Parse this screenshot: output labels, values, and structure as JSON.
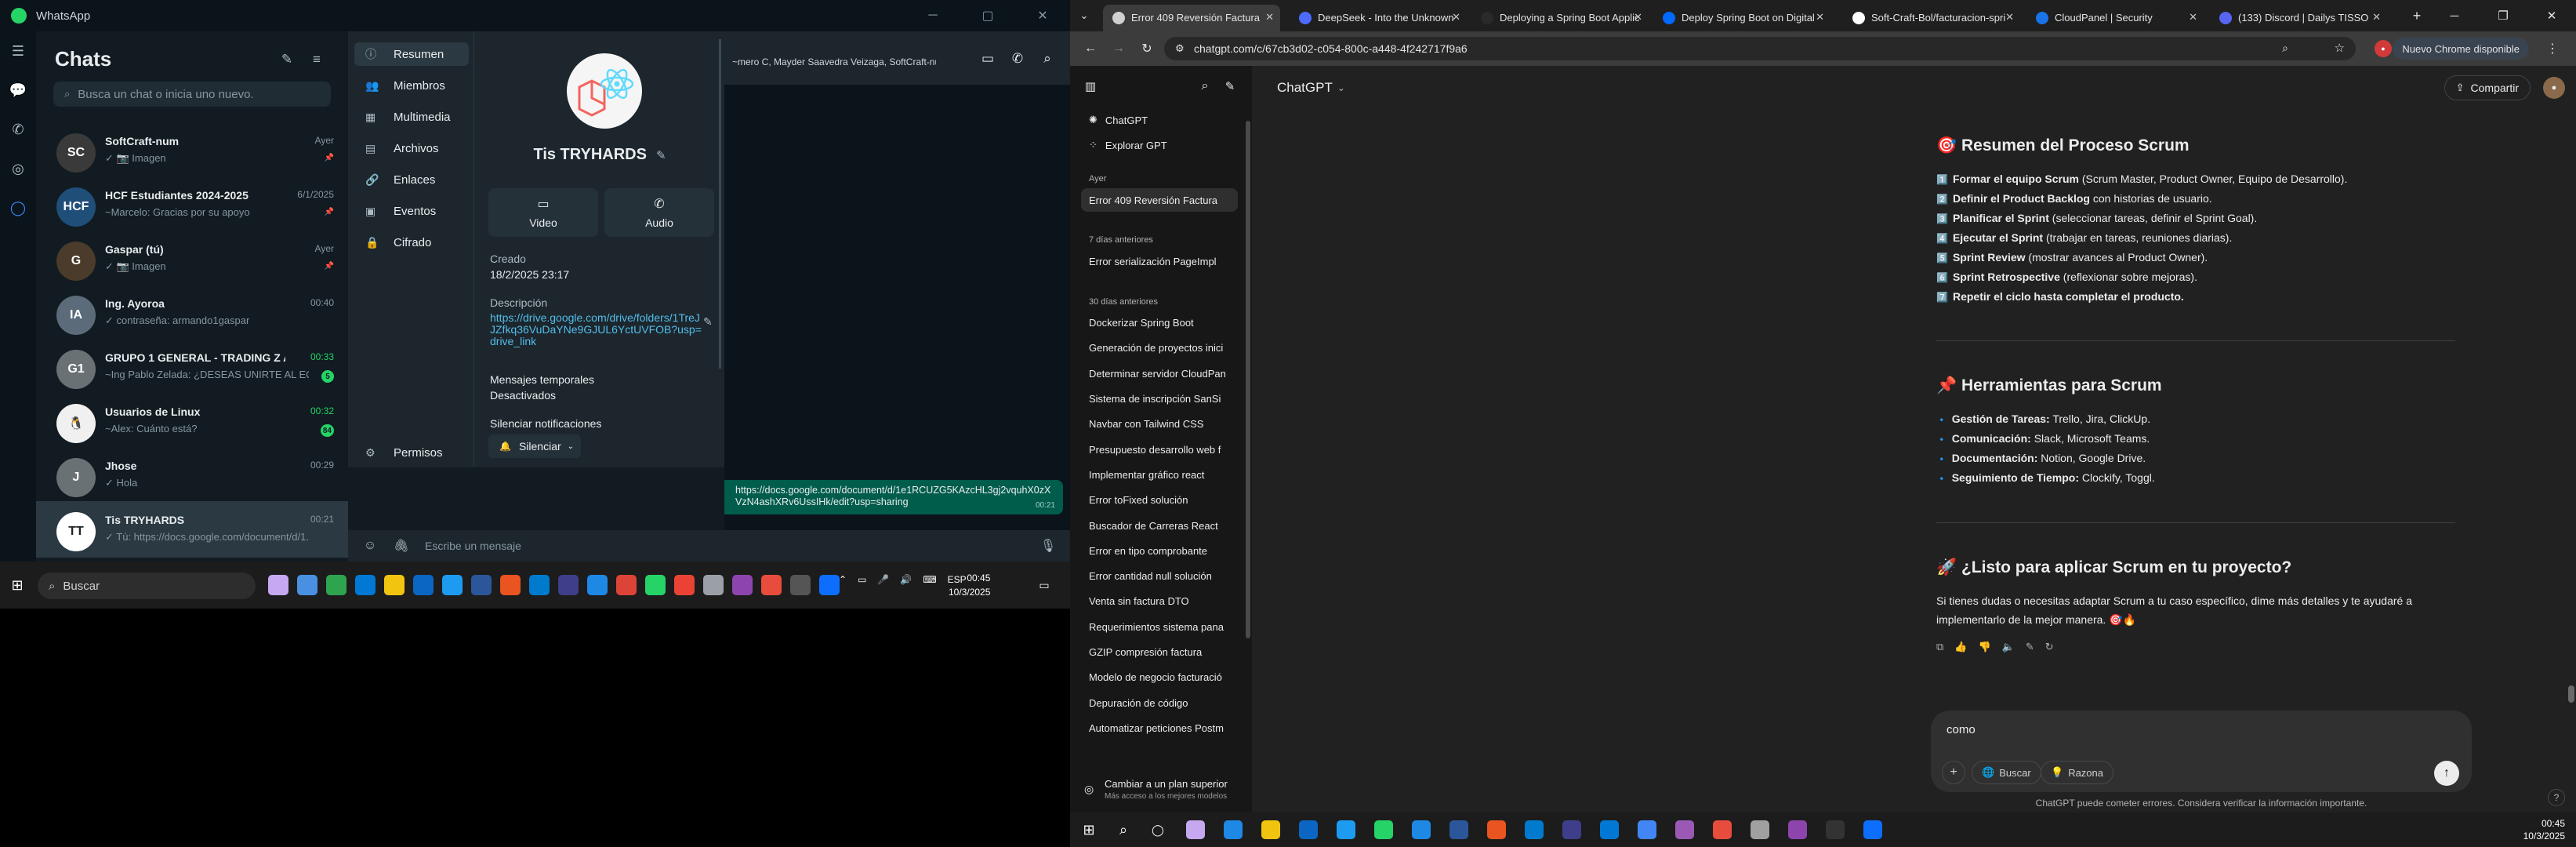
{
  "whatsapp": {
    "title": "WhatsApp",
    "list_title": "Chats",
    "search_placeholder": "Busca un chat o inicia uno nuevo.",
    "chats": [
      {
        "name": "SoftCraft-num",
        "preview": "✓ 📷 Imagen",
        "time": "Ayer",
        "avatar": "SC"
      },
      {
        "name": "HCF Estudiantes 2024-2025",
        "preview": "~Marcelo: Gracias por su apoyo",
        "time": "6/1/2025",
        "avatar": "HCF"
      },
      {
        "name": "Gaspar (tú)",
        "preview": "✓ 📷 Imagen",
        "time": "Ayer",
        "avatar": "G"
      },
      {
        "name": "Ing. Ayoroa",
        "preview": "✓ contraseña: armando1gaspar",
        "time": "00:40",
        "avatar": "IA"
      },
      {
        "name": "GRUPO 1 GENERAL - TRADING Z ACADE...",
        "preview": "~Ing Pablo Zelada: ¿DESEAS UNIRTE AL EQUIP...",
        "time": "00:33",
        "avatar": "G1",
        "badge": "5"
      },
      {
        "name": "Usuarios de Linux",
        "preview": "~Alex: Cuánto está?",
        "time": "00:32",
        "avatar": "🐧",
        "badge": "84"
      },
      {
        "name": "Jhose",
        "preview": "✓ Hola",
        "time": "00:29",
        "avatar": "J"
      },
      {
        "name": "Tis TRYHARDS",
        "preview": "✓ Tú: https://docs.google.com/document/d/1...",
        "time": "00:21",
        "avatar": "TT"
      }
    ],
    "info_nav": [
      "Resumen",
      "Miembros",
      "Multimedia",
      "Archivos",
      "Enlaces",
      "Eventos",
      "Cifrado",
      "Permisos"
    ],
    "info_nav_icons": [
      "ⓘ",
      "👥",
      "▦",
      "▤",
      "🔗",
      "▣",
      "🔒",
      "⚙"
    ],
    "group": {
      "name": "Tis TRYHARDS",
      "video_label": "Video",
      "audio_label": "Audio",
      "created_label": "Creado",
      "created_value": "18/2/2025 23:17",
      "description_label": "Descripción",
      "description_value": "https://drive.google.com/drive/folders/1TreJJZfkq36VuDaYNe9GJUL6YctUVFOB?usp=drive_link",
      "temp_label": "Mensajes temporales",
      "temp_value": "Desactivados",
      "silence_label": "Silenciar notificaciones",
      "silence_button": "Silenciar"
    },
    "chat": {
      "members": "~mero C, Mayder Saavedra Veizaga, SoftCraft-nu...",
      "message": "https://docs.google.com/document/d/1e1RCUZG5KAzcHL3gj2vquhX0zXVzN4ashXRv6UssIHk/edit?usp=sharing",
      "message_time": "00:21",
      "compose_placeholder": "Escribe un mensaje"
    }
  },
  "taskbar_left": {
    "search": "Buscar",
    "lang": "ESP",
    "time": "00:45",
    "date": "10/3/2025",
    "app_colors": [
      "#c5a8f0",
      "#4a90e2",
      "#2ea44f",
      "#0078d4",
      "#f1c40f",
      "#0a66c2",
      "#1d9bf0",
      "#2b579a",
      "#e95420",
      "#007acc",
      "#3e3e8a",
      "#1e88e5",
      "#db4437",
      "#25d366",
      "#ea4335",
      "#9aa0a6",
      "#8e44ad",
      "#e74c3c",
      "#555555",
      "#0d6efd"
    ]
  },
  "chrome": {
    "tabs": [
      {
        "title": "Error 409 Reversión Factura",
        "color": "#d0d0d0"
      },
      {
        "title": "DeepSeek - Into the Unknown",
        "color": "#4d6bfe"
      },
      {
        "title": "Deploying a Spring Boot Applic",
        "color": "#2a2a2a"
      },
      {
        "title": "Deploy Spring Boot on Digital",
        "color": "#0069ff"
      },
      {
        "title": "Soft-Craft-Bol/facturacion-spri",
        "color": "#ffffff"
      },
      {
        "title": "CloudPanel | Security",
        "color": "#1a73e8"
      },
      {
        "title": "(133) Discord | Dailys TISSO",
        "color": "#5865f2"
      }
    ],
    "url": "chatgpt.com/c/67cb3d02-c054-800c-a448-4f242717f9a6",
    "profile_button": "Nuevo Chrome disponible",
    "sidebar": {
      "top": [
        {
          "label": "ChatGPT"
        },
        {
          "label": "Explorar GPT"
        }
      ],
      "sections": [
        {
          "heading": "Ayer",
          "items": [
            "Error 409 Reversión Factura"
          ]
        },
        {
          "heading": "7 días anteriores",
          "items": [
            "Error serialización PageImpl"
          ]
        },
        {
          "heading": "30 días anteriores",
          "items": [
            "Dockerizar Spring Boot",
            "Generación de proyectos inici",
            "Determinar servidor CloudPan",
            "Sistema de inscripción SanSi",
            "Navbar con Tailwind CSS",
            "Presupuesto desarrollo web f",
            "Implementar gráfico react",
            "Error toFixed solución",
            "Buscador de Carreras React",
            "Error en tipo comprobante",
            "Error cantidad null solución",
            "Venta sin factura DTO",
            "Requerimientos sistema pana",
            "GZIP compresión factura",
            "Modelo de negocio facturació",
            "Depuración de código",
            "Automatizar peticiones Postm"
          ]
        }
      ],
      "upgrade_title": "Cambiar a un plan superior",
      "upgrade_sub": "Más acceso a los mejores modelos"
    },
    "main": {
      "model": "ChatGPT",
      "share": "Compartir",
      "h1": "🎯 Resumen del Proceso Scrum",
      "steps": [
        {
          "n": "1️⃣",
          "b": "Formar el equipo Scrum",
          "t": " (Scrum Master, Product Owner, Equipo de Desarrollo)."
        },
        {
          "n": "2️⃣",
          "b": "Definir el Product Backlog",
          "t": " con historias de usuario."
        },
        {
          "n": "3️⃣",
          "b": "Planificar el Sprint",
          "t": " (seleccionar tareas, definir el Sprint Goal)."
        },
        {
          "n": "4️⃣",
          "b": "Ejecutar el Sprint",
          "t": " (trabajar en tareas, reuniones diarias)."
        },
        {
          "n": "5️⃣",
          "b": "Sprint Review",
          "t": " (mostrar avances al Product Owner)."
        },
        {
          "n": "6️⃣",
          "b": "Sprint Retrospective",
          "t": " (reflexionar sobre mejoras)."
        },
        {
          "n": "7️⃣",
          "b": "Repetir el ciclo hasta completar el producto.",
          "t": ""
        }
      ],
      "h2": "📌 Herramientas para Scrum",
      "tools": [
        {
          "b": "Gestión de Tareas:",
          "t": " Trello, Jira, ClickUp."
        },
        {
          "b": "Comunicación:",
          "t": " Slack, Microsoft Teams."
        },
        {
          "b": "Documentación:",
          "t": " Notion, Google Drive."
        },
        {
          "b": "Seguimiento de Tiempo:",
          "t": " Clockify, Toggl."
        }
      ],
      "h3": "🚀 ¿Listo para aplicar Scrum en tu proyecto?",
      "para1": "Si tienes dudas o necesitas adaptar Scrum a tu caso específico, dime más detalles y te ayudaré a",
      "para2": "implementarlo de la mejor manera. 🎯🔥",
      "composer_text": "como",
      "search_btn": "Buscar",
      "reason_btn": "Razona",
      "footer": "ChatGPT puede cometer errores. Considera verificar la información importante."
    }
  },
  "taskbar_right": {
    "time": "00:45",
    "date": "10/3/2025",
    "app_colors": [
      "#c5a8f0",
      "#1e88e5",
      "#f1c40f",
      "#0a66c2",
      "#1d9bf0",
      "#25d366",
      "#1e88e5",
      "#2b579a",
      "#e95420",
      "#007acc",
      "#3e3e8a",
      "#0078d4",
      "#4285f4",
      "#9b59b6",
      "#e74c3c",
      "#a0a0a0",
      "#8e44ad",
      "#333333",
      "#0d6efd"
    ]
  }
}
